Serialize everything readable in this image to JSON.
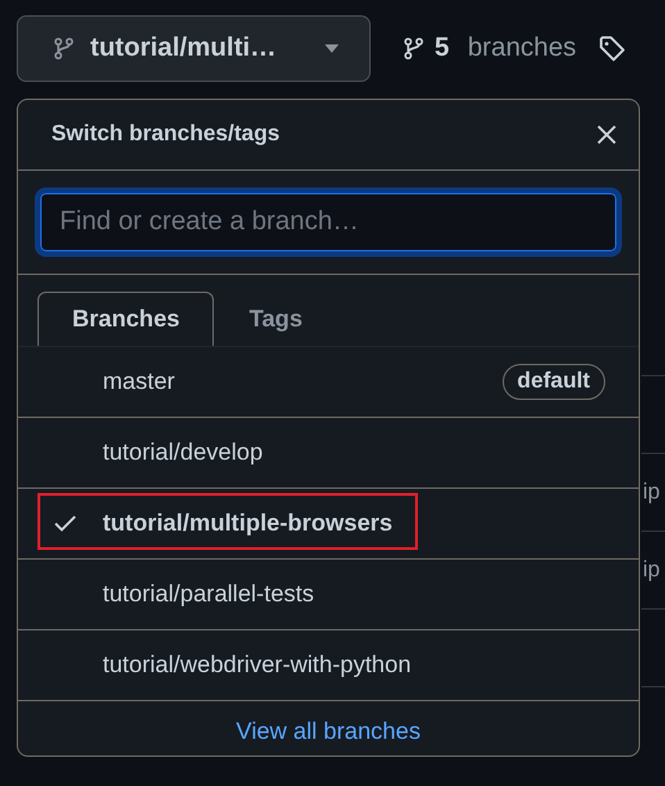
{
  "branch_button": {
    "label": "tutorial/multi…"
  },
  "branch_count": {
    "count": "5",
    "label": "branches"
  },
  "menu": {
    "title": "Switch branches/tags",
    "search": {
      "placeholder": "Find or create a branch…"
    },
    "tabs": [
      {
        "label": "Branches",
        "selected": true
      },
      {
        "label": "Tags",
        "selected": false
      }
    ],
    "branches": [
      {
        "name": "master",
        "selected": false,
        "highlighted": false,
        "badge": "default"
      },
      {
        "name": "tutorial/develop",
        "selected": false,
        "highlighted": false
      },
      {
        "name": "tutorial/multiple-browsers",
        "selected": true,
        "highlighted": true
      },
      {
        "name": "tutorial/parallel-tests",
        "selected": false,
        "highlighted": false
      },
      {
        "name": "tutorial/webdriver-with-python",
        "selected": false,
        "highlighted": false
      }
    ],
    "footer_link": "View all branches"
  },
  "background_rows": [
    {
      "text": "ip"
    },
    {
      "text": "ip"
    }
  ]
}
